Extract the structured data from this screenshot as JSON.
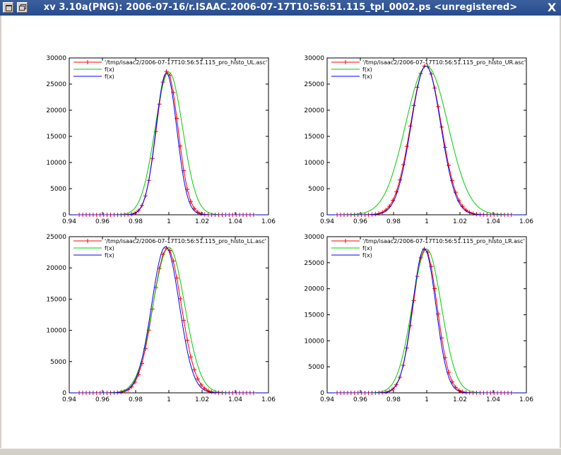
{
  "window": {
    "title": "xv 3.10a(PNG): 2006-07-16/r.ISAAC.2006-07-17T10:56:51.115_tpl_0002.ps <unregistered>",
    "close_glyph": "X"
  },
  "colors": {
    "data": "#ff0000",
    "fit1": "#00cc00",
    "fit2": "#0000ff"
  },
  "chart_data": [
    {
      "type": "line",
      "panel": "top-left",
      "xlim": [
        0.94,
        1.06
      ],
      "ylim": [
        0,
        30000
      ],
      "x_ticks": [
        "0.94",
        "0.96",
        "0.98",
        "1",
        "1.02",
        "1.04",
        "1.06"
      ],
      "y_ticks": [
        "0",
        "5000",
        "10000",
        "15000",
        "20000",
        "25000",
        "30000"
      ],
      "legend_position": "top-left",
      "series": [
        {
          "name": "'/tmp/isaac2/2006-07-17T10:56:51.115_pro_histo_UL.asc'",
          "kind": "points",
          "color": "#ff0000",
          "amplitude": 27500,
          "center": 0.999,
          "sigma": 0.0065
        },
        {
          "name": "f(x)",
          "kind": "curve",
          "color": "#00cc00",
          "amplitude": 27300,
          "center": 1.0,
          "sigma": 0.0083
        },
        {
          "name": "f(x)",
          "kind": "curve",
          "color": "#0000ff",
          "amplitude": 27100,
          "center": 0.9985,
          "sigma": 0.0063
        }
      ]
    },
    {
      "type": "line",
      "panel": "top-right",
      "xlim": [
        0.94,
        1.06
      ],
      "ylim": [
        0,
        30000
      ],
      "x_ticks": [
        "0.94",
        "0.96",
        "0.98",
        "1",
        "1.02",
        "1.04",
        "1.06"
      ],
      "y_ticks": [
        "0",
        "5000",
        "10000",
        "15000",
        "20000",
        "25000",
        "30000"
      ],
      "legend_position": "top-left",
      "series": [
        {
          "name": "'/tmp/isaac2/2006-07-17T10:56:51.115_pro_histo_UR.asc'",
          "kind": "points",
          "color": "#ff0000",
          "amplitude": 28600,
          "center": 0.9995,
          "sigma": 0.0092
        },
        {
          "name": "f(x)",
          "kind": "curve",
          "color": "#00cc00",
          "amplitude": 28400,
          "center": 1.0,
          "sigma": 0.0128
        },
        {
          "name": "f(x)",
          "kind": "curve",
          "color": "#0000ff",
          "amplitude": 28500,
          "center": 0.9995,
          "sigma": 0.0089
        }
      ]
    },
    {
      "type": "line",
      "panel": "bottom-left",
      "xlim": [
        0.94,
        1.06
      ],
      "ylim": [
        0,
        25000
      ],
      "x_ticks": [
        "0.94",
        "0.96",
        "0.98",
        "1",
        "1.02",
        "1.04",
        "1.06"
      ],
      "y_ticks": [
        "0",
        "5000",
        "10000",
        "15000",
        "20000",
        "25000"
      ],
      "legend_position": "top-left",
      "series": [
        {
          "name": "'/tmp/isaac2/2006-07-17T10:56:51.115_pro_histo_LL.asc'",
          "kind": "points",
          "color": "#ff0000",
          "amplitude": 23200,
          "center": 0.999,
          "sigma": 0.0085
        },
        {
          "name": "f(x)",
          "kind": "curve",
          "color": "#00cc00",
          "amplitude": 23300,
          "center": 1.0,
          "sigma": 0.0095
        },
        {
          "name": "f(x)",
          "kind": "curve",
          "color": "#0000ff",
          "amplitude": 23400,
          "center": 0.998,
          "sigma": 0.0083
        }
      ]
    },
    {
      "type": "line",
      "panel": "bottom-right",
      "xlim": [
        0.94,
        1.06
      ],
      "ylim": [
        0,
        30000
      ],
      "x_ticks": [
        "0.94",
        "0.96",
        "0.98",
        "1",
        "1.02",
        "1.04",
        "1.06"
      ],
      "y_ticks": [
        "0",
        "5000",
        "10000",
        "15000",
        "20000",
        "25000",
        "30000"
      ],
      "legend_position": "top-left",
      "series": [
        {
          "name": "'/tmp/isaac2/2006-07-17T10:56:51.115_pro_histo_LR.asc'",
          "kind": "points",
          "color": "#ff0000",
          "amplitude": 27700,
          "center": 0.999,
          "sigma": 0.0072
        },
        {
          "name": "f(x)",
          "kind": "curve",
          "color": "#00cc00",
          "amplitude": 27600,
          "center": 1.0,
          "sigma": 0.0088
        },
        {
          "name": "f(x)",
          "kind": "curve",
          "color": "#0000ff",
          "amplitude": 27700,
          "center": 0.9985,
          "sigma": 0.007
        }
      ]
    }
  ]
}
